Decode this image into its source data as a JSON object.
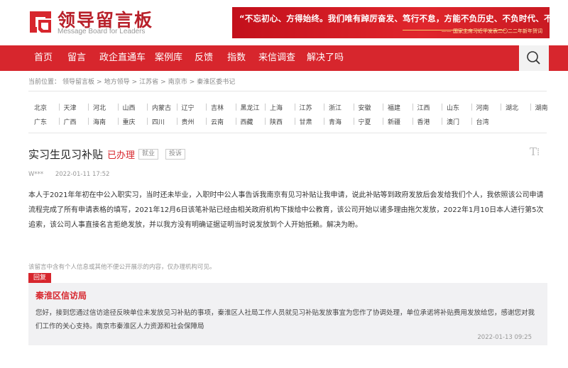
{
  "header": {
    "logo_title": "领导留言板",
    "logo_sub": "Message Board for Leaders",
    "banner_main": "“不忘初心、方得始终。我们唯有踔厉奋发、笃行不怠，方能不负历史、不负时代、不负人民。”",
    "banner_sub": "—— 国家主席习近平发表二〇二二年新年贺词",
    "brand_color": "#d7262d"
  },
  "nav": {
    "items": [
      "首页",
      "留言",
      "政企直通车",
      "案例库",
      "反馈",
      "指数",
      "来信调查",
      "解决了吗"
    ],
    "search_icon": "search-icon"
  },
  "breadcrumb": {
    "items": [
      "当前位置：",
      "领导留言板",
      ">",
      "地方领导",
      ">",
      "江苏省",
      ">",
      "南京市",
      ">",
      "秦淮区委书记"
    ]
  },
  "regions": {
    "row1": [
      "北京",
      "天津",
      "河北",
      "山西",
      "内蒙古",
      "辽宁",
      "吉林",
      "黑龙江",
      "上海",
      "江苏",
      "浙江",
      "安徽",
      "福建",
      "江西",
      "山东",
      "河南",
      "湖北",
      "湖南"
    ],
    "row2": [
      "广东",
      "广西",
      "海南",
      "重庆",
      "四川",
      "贵州",
      "云南",
      "西藏",
      "陕西",
      "甘肃",
      "青海",
      "宁夏",
      "新疆",
      "香港",
      "澳门",
      "台湾"
    ]
  },
  "message": {
    "title": "实习生见习补贴",
    "status": "已办理",
    "tags": [
      "就业",
      "投诉"
    ],
    "font_icon": "text-size-icon",
    "font_icon_glyph": "T⁞",
    "author": "W***",
    "time": "2022-01-11 17:52",
    "body": "本人于2021年年初在中公入职实习，当时还未毕业，入职时中公人事告诉我南京有见习补贴让我申请，说此补贴等到政府发放后会发给我们个人，我依照该公司申请表格的填写，2021年12月6日该笔补贴已经由相关政府机构下拨给中公教育，该公司开始以诸多理由拖欠发放，2022年1月10日本人进行第5次追索，该公司人事直接名言拒绝发放，并以我方没有明确证据证明当时说发放到个人开始抵赖。解决为盼。",
    "body_prefix": "本人于2021年年初在中公入职实习，当时还未毕业，入职时中公人事告诉我南京有见习补贴让我申请，说此补贴等到政府发放后会发给我们个人，我依照该公司申请流程完成了所有申请表格的填写，2021年12月6日该笔补贴已经由相关政府机构下拨给中公教育，该公司开始以诸多理由拖欠发放，2022年1月10日本人进行第5次追索，该公司人事直接名言拒绝发放，并以我方没有明确证据证明当时说发放到个人开始抵赖。解决为盼。"
  },
  "privacy_note": "该留言中含有个人信息或其他不便公开展示的内容，仅办理机构可见。",
  "reply": {
    "label": "回复",
    "org": "秦淮区信访局",
    "text": "您好，接到您通过信访途径反映单位未发放见习补贴的事项，秦淮区人社局工作人员就见习补贴发放事宜为您作了协调处理，单位承诺将补贴费用发放给您，感谢您对我们工作的关心支持。南京市秦淮区人力资源和社会保障局",
    "time": "2022-01-13 09:25"
  }
}
